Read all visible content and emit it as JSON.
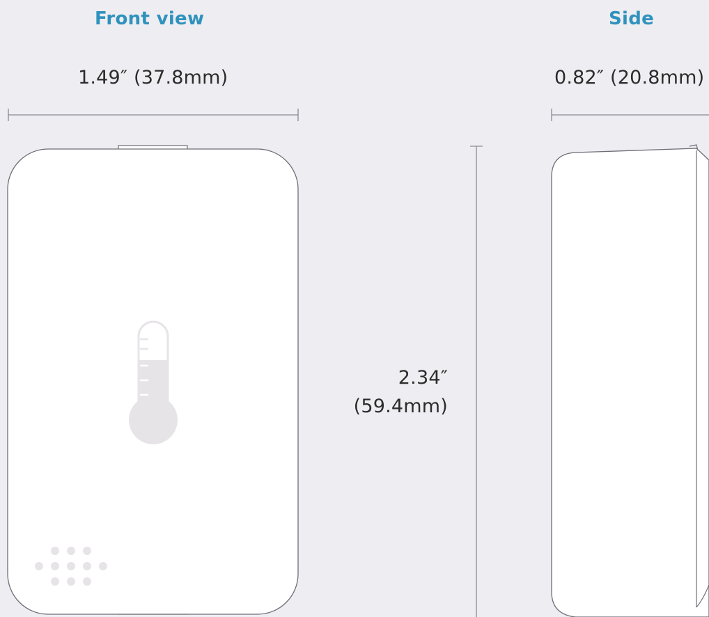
{
  "headings": {
    "front": "Front view",
    "side": "Side"
  },
  "dimensions": {
    "width": "1.49″ (37.8mm)",
    "depth": "0.82″ (20.8mm)",
    "height_line1": "2.34″",
    "height_line2": "(59.4mm)"
  },
  "icons": {
    "front_face": "thermometer-icon",
    "bottom_left": "speaker-grille-icon"
  },
  "colors": {
    "heading": "#2f92bd",
    "background": "#eeedf1",
    "device": "#ffffff",
    "outline": "#6e6e78",
    "icon": "#e7e4e8"
  }
}
